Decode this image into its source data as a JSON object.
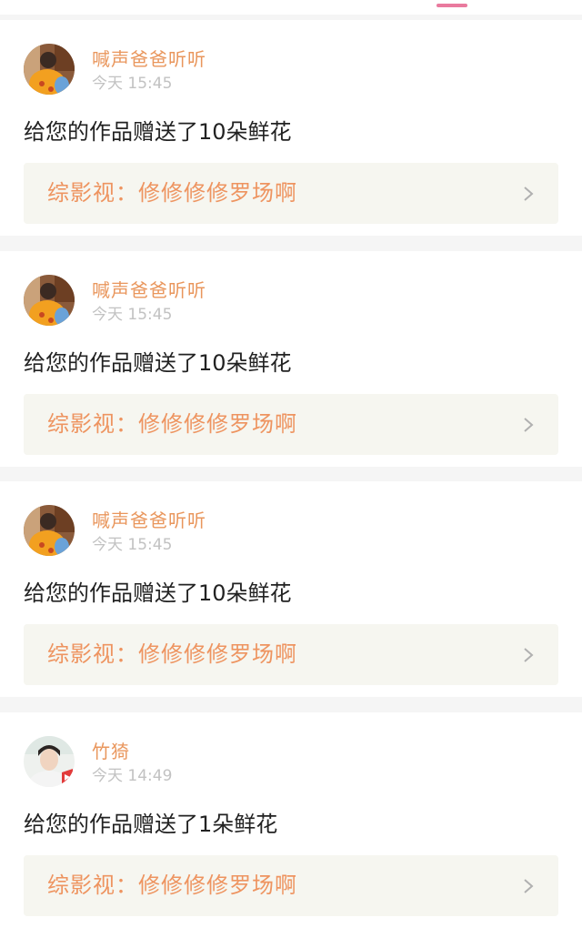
{
  "theme": {
    "accent": "#e97a9e",
    "username_color": "#e9965c",
    "work_title_color": "#ee9460",
    "work_bg": "#f6f6f0",
    "chevron_color": "#b0b0b0"
  },
  "notifications": [
    {
      "avatar_icon": "avatar-photo-orange-icon",
      "username": "喊声爸爸听听",
      "time": "今天 15:45",
      "message": "给您的作品赠送了10朵鲜花",
      "work_title": "综影视：修修修修罗场啊"
    },
    {
      "avatar_icon": "avatar-photo-orange-icon",
      "username": "喊声爸爸听听",
      "time": "今天 15:45",
      "message": "给您的作品赠送了10朵鲜花",
      "work_title": "综影视：修修修修罗场啊"
    },
    {
      "avatar_icon": "avatar-photo-orange-icon",
      "username": "喊声爸爸听听",
      "time": "今天 15:45",
      "message": "给您的作品赠送了10朵鲜花",
      "work_title": "综影视：修修修修罗场啊"
    },
    {
      "avatar_icon": "avatar-photo-portrait-icon",
      "username": "竹猗",
      "time": "今天 14:49",
      "message": "给您的作品赠送了1朵鲜花",
      "work_title": "综影视：修修修修罗场啊"
    }
  ]
}
